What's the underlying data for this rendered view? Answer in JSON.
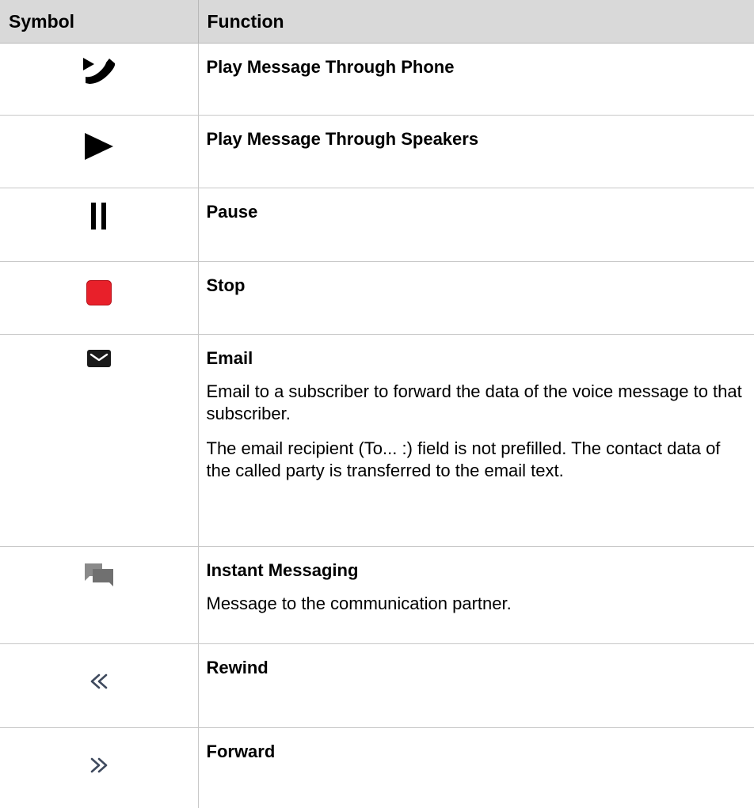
{
  "table": {
    "headers": {
      "symbol": "Symbol",
      "function": "Function"
    },
    "rows": [
      {
        "icon": "phone-play-icon",
        "title": "Play Message Through Phone"
      },
      {
        "icon": "play-icon",
        "title": "Play Message Through Speakers"
      },
      {
        "icon": "pause-icon",
        "title": "Pause"
      },
      {
        "icon": "stop-icon",
        "icon_color": "#e8202a",
        "title": "Stop"
      },
      {
        "icon": "email-icon",
        "title": "Email",
        "description": [
          "Email to a subscriber to forward the data of the voice message to that subscriber.",
          "The email recipient (To... :) field is not prefilled. The contact data of the called party is transferred to the email text."
        ]
      },
      {
        "icon": "instant-messaging-icon",
        "icon_color": "#707070",
        "title": "Instant Messaging",
        "description": [
          "Message to the communication partner."
        ]
      },
      {
        "icon": "rewind-icon",
        "icon_color": "#3f4a5e",
        "title": "Rewind"
      },
      {
        "icon": "forward-icon",
        "icon_color": "#3f4a5e",
        "title": "Forward"
      }
    ]
  }
}
